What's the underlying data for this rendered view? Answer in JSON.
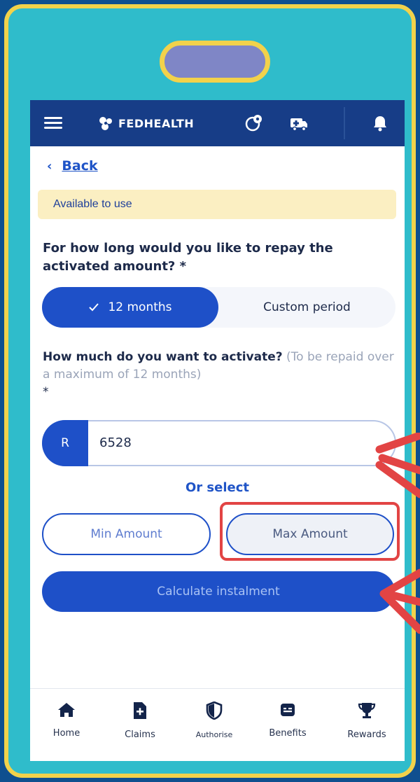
{
  "app": {
    "brand": "FEDHEALTH"
  },
  "nav": {
    "back_label": "Back"
  },
  "notice": {
    "text": "Available to use"
  },
  "repay": {
    "question": "For how long would you like to repay the activated amount? *",
    "options": [
      {
        "label": "12 months",
        "selected": true
      },
      {
        "label": "Custom period",
        "selected": false
      }
    ]
  },
  "activate": {
    "question_strong": "How much do you want to activate?",
    "question_muted": " (To be repaid over a maximum of 12 months)",
    "required_mark": "*",
    "currency": "R",
    "value": "6528"
  },
  "select": {
    "or_label": "Or select",
    "min_label": "Min Amount",
    "max_label": "Max Amount",
    "calculate_label": "Calculate instalment"
  },
  "bottom_nav": {
    "items": [
      {
        "label": "Home",
        "icon": "home-icon"
      },
      {
        "label": "Claims",
        "icon": "claims-icon"
      },
      {
        "label": "Authorise",
        "icon": "shield-icon"
      },
      {
        "label": "Benefits",
        "icon": "benefits-icon"
      },
      {
        "label": "Rewards",
        "icon": "trophy-icon"
      }
    ]
  },
  "colors": {
    "primary": "#1e50c8",
    "header": "#173d87",
    "frame": "#2fbccb",
    "frame_border": "#f2d24b",
    "highlight": "#e24444"
  }
}
